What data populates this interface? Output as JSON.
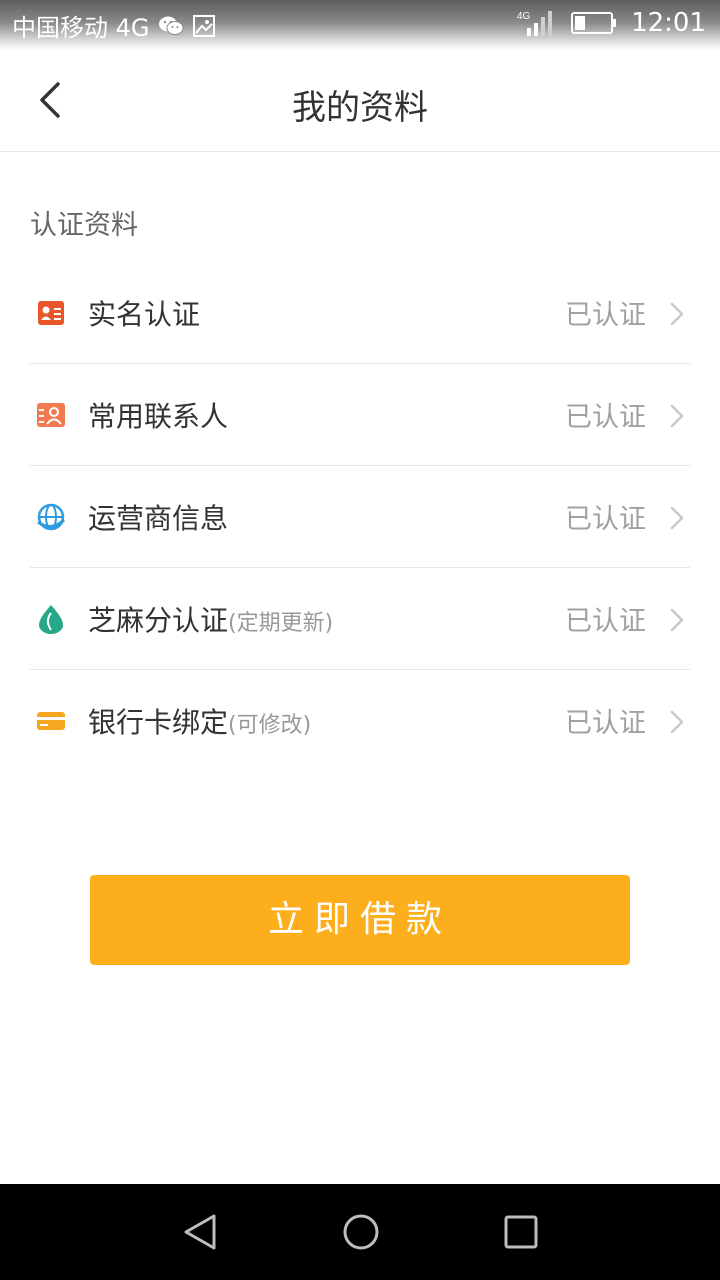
{
  "status_bar": {
    "carrier": "中国移动 4G",
    "net_label": "4G",
    "time": "12:01"
  },
  "header": {
    "title": "我的资料"
  },
  "section": {
    "title": "认证资料"
  },
  "items": [
    {
      "label": "实名认证",
      "note": "",
      "status": "已认证",
      "icon": "id-card-icon",
      "color": "#e8562a"
    },
    {
      "label": "常用联系人",
      "note": "",
      "status": "已认证",
      "icon": "contacts-icon",
      "color": "#f27a52"
    },
    {
      "label": "运营商信息",
      "note": "",
      "status": "已认证",
      "icon": "globe-icon",
      "color": "#2f9be0"
    },
    {
      "label": "芝麻分认证",
      "note": "(定期更新)",
      "status": "已认证",
      "icon": "sesame-icon",
      "color": "#27a88a"
    },
    {
      "label": "银行卡绑定",
      "note": "(可修改)",
      "status": "已认证",
      "icon": "bank-card-icon",
      "color": "#f6a623"
    }
  ],
  "action": {
    "loan_label": "立即借款"
  },
  "colors": {
    "accent": "#fcae1c"
  }
}
